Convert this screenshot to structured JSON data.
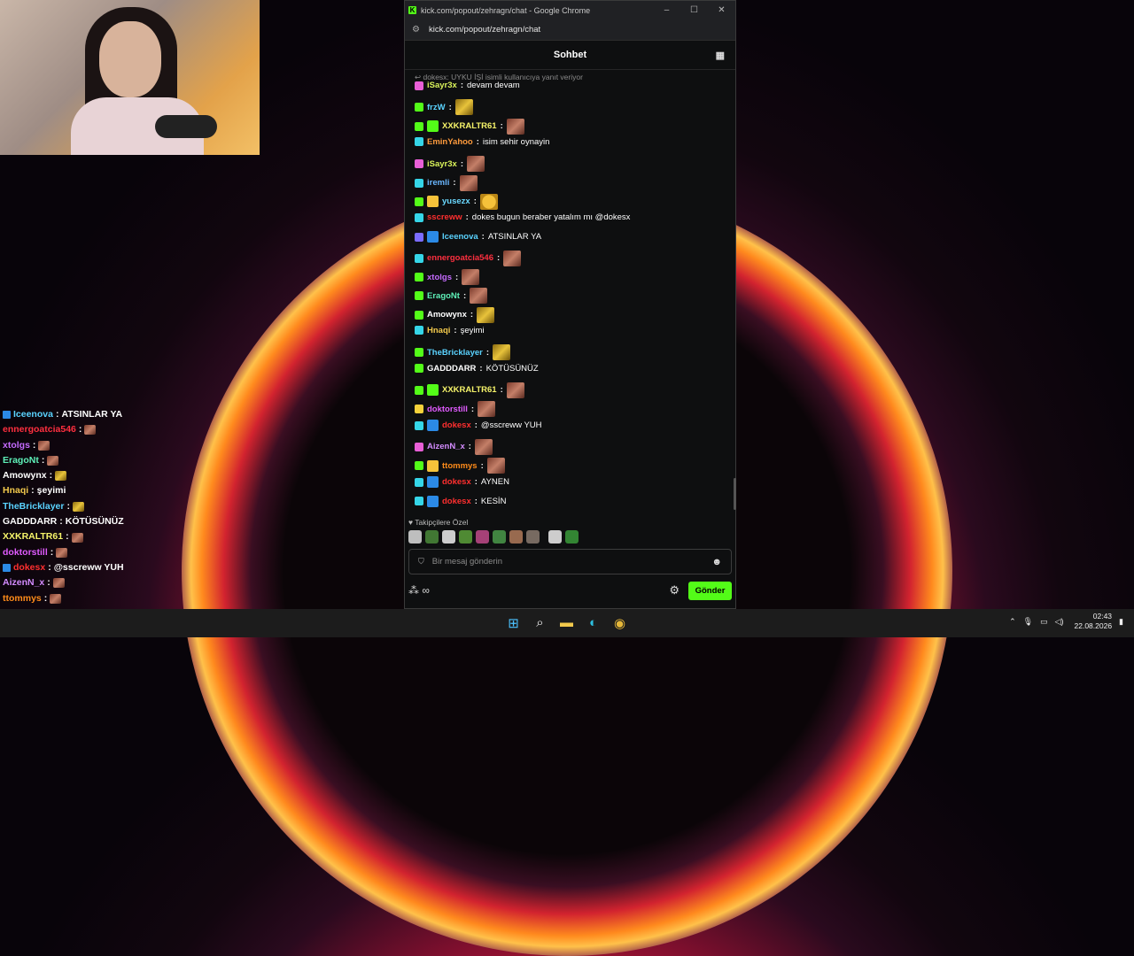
{
  "window": {
    "title": "kick.com/popout/zehragn/chat - Google Chrome",
    "url": "kick.com/popout/zehragn/chat",
    "controls": [
      "–",
      "☐",
      "✕"
    ]
  },
  "chat": {
    "header": "Sohbet",
    "reply_note": "dokesx: UYKU İŞİ isimli kullanıcıya yanıt veriyor",
    "messages": [
      {
        "user": "iSayr3x",
        "color": "#d9f25a",
        "badge": "#e85fd6",
        "text": "devam devam"
      },
      {
        "user": "frzW",
        "color": "#5ad3ff",
        "badge": "#53fc18",
        "emote": "gold"
      },
      {
        "user": "XXKRALTR61",
        "color": "#f6f46a",
        "badge": "#53fc18",
        "icon": "#53fc18",
        "emote": "face"
      },
      {
        "user": "EminYahoo",
        "color": "#ff9b3d",
        "badge": "#35d6e8",
        "text": "isim sehir oynayin"
      },
      {
        "user": "iSayr3x",
        "color": "#d9f25a",
        "badge": "#e85fd6",
        "emote": "face"
      },
      {
        "user": "iremli",
        "color": "#6ab7ff",
        "badge": "#35d6e8",
        "emote": "face"
      },
      {
        "user": "yusezx",
        "color": "#6ad9ff",
        "badge": "#53fc18",
        "icon": "#f5c23a",
        "emote": "smile"
      },
      {
        "user": "sscreww",
        "color": "#ff2f2f",
        "badge": "#35d6e8",
        "text": "dokes bugun beraber yatalım mı @dokesx"
      },
      {
        "user": "Iceenova",
        "color": "#5ad3ff",
        "badge": "#7b6cff",
        "icon": "#2b8ae6",
        "text": "ATSINLAR YA"
      },
      {
        "user": "ennergoatcia546",
        "color": "#ff2f3f",
        "badge": "#35d6e8",
        "emote": "face"
      },
      {
        "user": "xtolgs",
        "color": "#c56bff",
        "badge": "#53fc18",
        "emote": "face"
      },
      {
        "user": "EragoNt",
        "color": "#5ef0b8",
        "badge": "#53fc18",
        "emote": "face"
      },
      {
        "user": "Amowynx",
        "color": "#ffffff",
        "badge": "#53fc18",
        "emote": "gold"
      },
      {
        "user": "Hnaqi",
        "color": "#f2c94c",
        "badge": "#35d6e8",
        "text": "şeyimi"
      },
      {
        "user": "TheBricklayer",
        "color": "#5ad3ff",
        "badge": "#53fc18",
        "emote": "gold"
      },
      {
        "user": "GADDDARR",
        "color": "#ffffff",
        "badge": "#53fc18",
        "text": "KÖTÜSÜNÜZ"
      },
      {
        "user": "XXKRALTR61",
        "color": "#f6f46a",
        "badge": "#53fc18",
        "icon": "#53fc18",
        "emote": "face"
      },
      {
        "user": "doktorstill",
        "color": "#e05bff",
        "badge": "#f5d23a",
        "emote": "face"
      },
      {
        "user": "dokesx",
        "color": "#ff2f2f",
        "badge": "#35d6e8",
        "icon": "#2b8ae6",
        "text": "@sscreww YUH"
      },
      {
        "user": "AizenN_x",
        "color": "#d48cff",
        "badge": "#e85fd6",
        "emote": "face"
      },
      {
        "user": "ttommys",
        "color": "#ff8c1a",
        "badge": "#53fc18",
        "icon": "#f5c23a",
        "emote": "face"
      },
      {
        "user": "dokesx",
        "color": "#ff2f2f",
        "badge": "#35d6e8",
        "icon": "#2b8ae6",
        "text": "AYNEN"
      },
      {
        "user": "dokesx",
        "color": "#ff2f2f",
        "badge": "#35d6e8",
        "icon": "#2b8ae6",
        "text": "KESİN"
      }
    ],
    "followers_label": "♥ Takipçilere Özel",
    "input_placeholder": "Bir mesaj gönderin",
    "send_label": "Gönder"
  },
  "overlay": [
    {
      "user": "Iceenova",
      "color": "#5ad3ff",
      "icon": true,
      "text": "ATSINLAR YA"
    },
    {
      "user": "ennergoatcia546",
      "color": "#ff2f3f",
      "emote": "face"
    },
    {
      "user": "xtolgs",
      "color": "#c56bff",
      "emote": "face"
    },
    {
      "user": "EragoNt",
      "color": "#5ef0b8",
      "emote": "face"
    },
    {
      "user": "Amowynx",
      "color": "#ffffff",
      "emote": "gold"
    },
    {
      "user": "Hnaqi",
      "color": "#f2c94c",
      "text": "şeyimi"
    },
    {
      "user": "TheBricklayer",
      "color": "#5ad3ff",
      "emote": "gold"
    },
    {
      "user": "GADDDARR",
      "color": "#ffffff",
      "text": "KÖTÜSÜNÜZ"
    },
    {
      "user": "XXKRALTR61",
      "color": "#f6f46a",
      "emote": "face"
    },
    {
      "user": "doktorstill",
      "color": "#e05bff",
      "emote": "face"
    },
    {
      "user": "dokesx",
      "color": "#ff2f2f",
      "icon": true,
      "text": "@sscreww YUH"
    },
    {
      "user": "AizenN_x",
      "color": "#d48cff",
      "emote": "face"
    },
    {
      "user": "ttommys",
      "color": "#ff8c1a",
      "emote": "face"
    },
    {
      "user": "dokesx",
      "color": "#ff2f2f",
      "icon": true,
      "text": "AYNEN"
    },
    {
      "user": "dokesx",
      "color": "#ff2f2f",
      "icon": true,
      "text": "KESİN"
    }
  ],
  "taskbar": {
    "time": "02:43",
    "date": "22.08.2026"
  }
}
